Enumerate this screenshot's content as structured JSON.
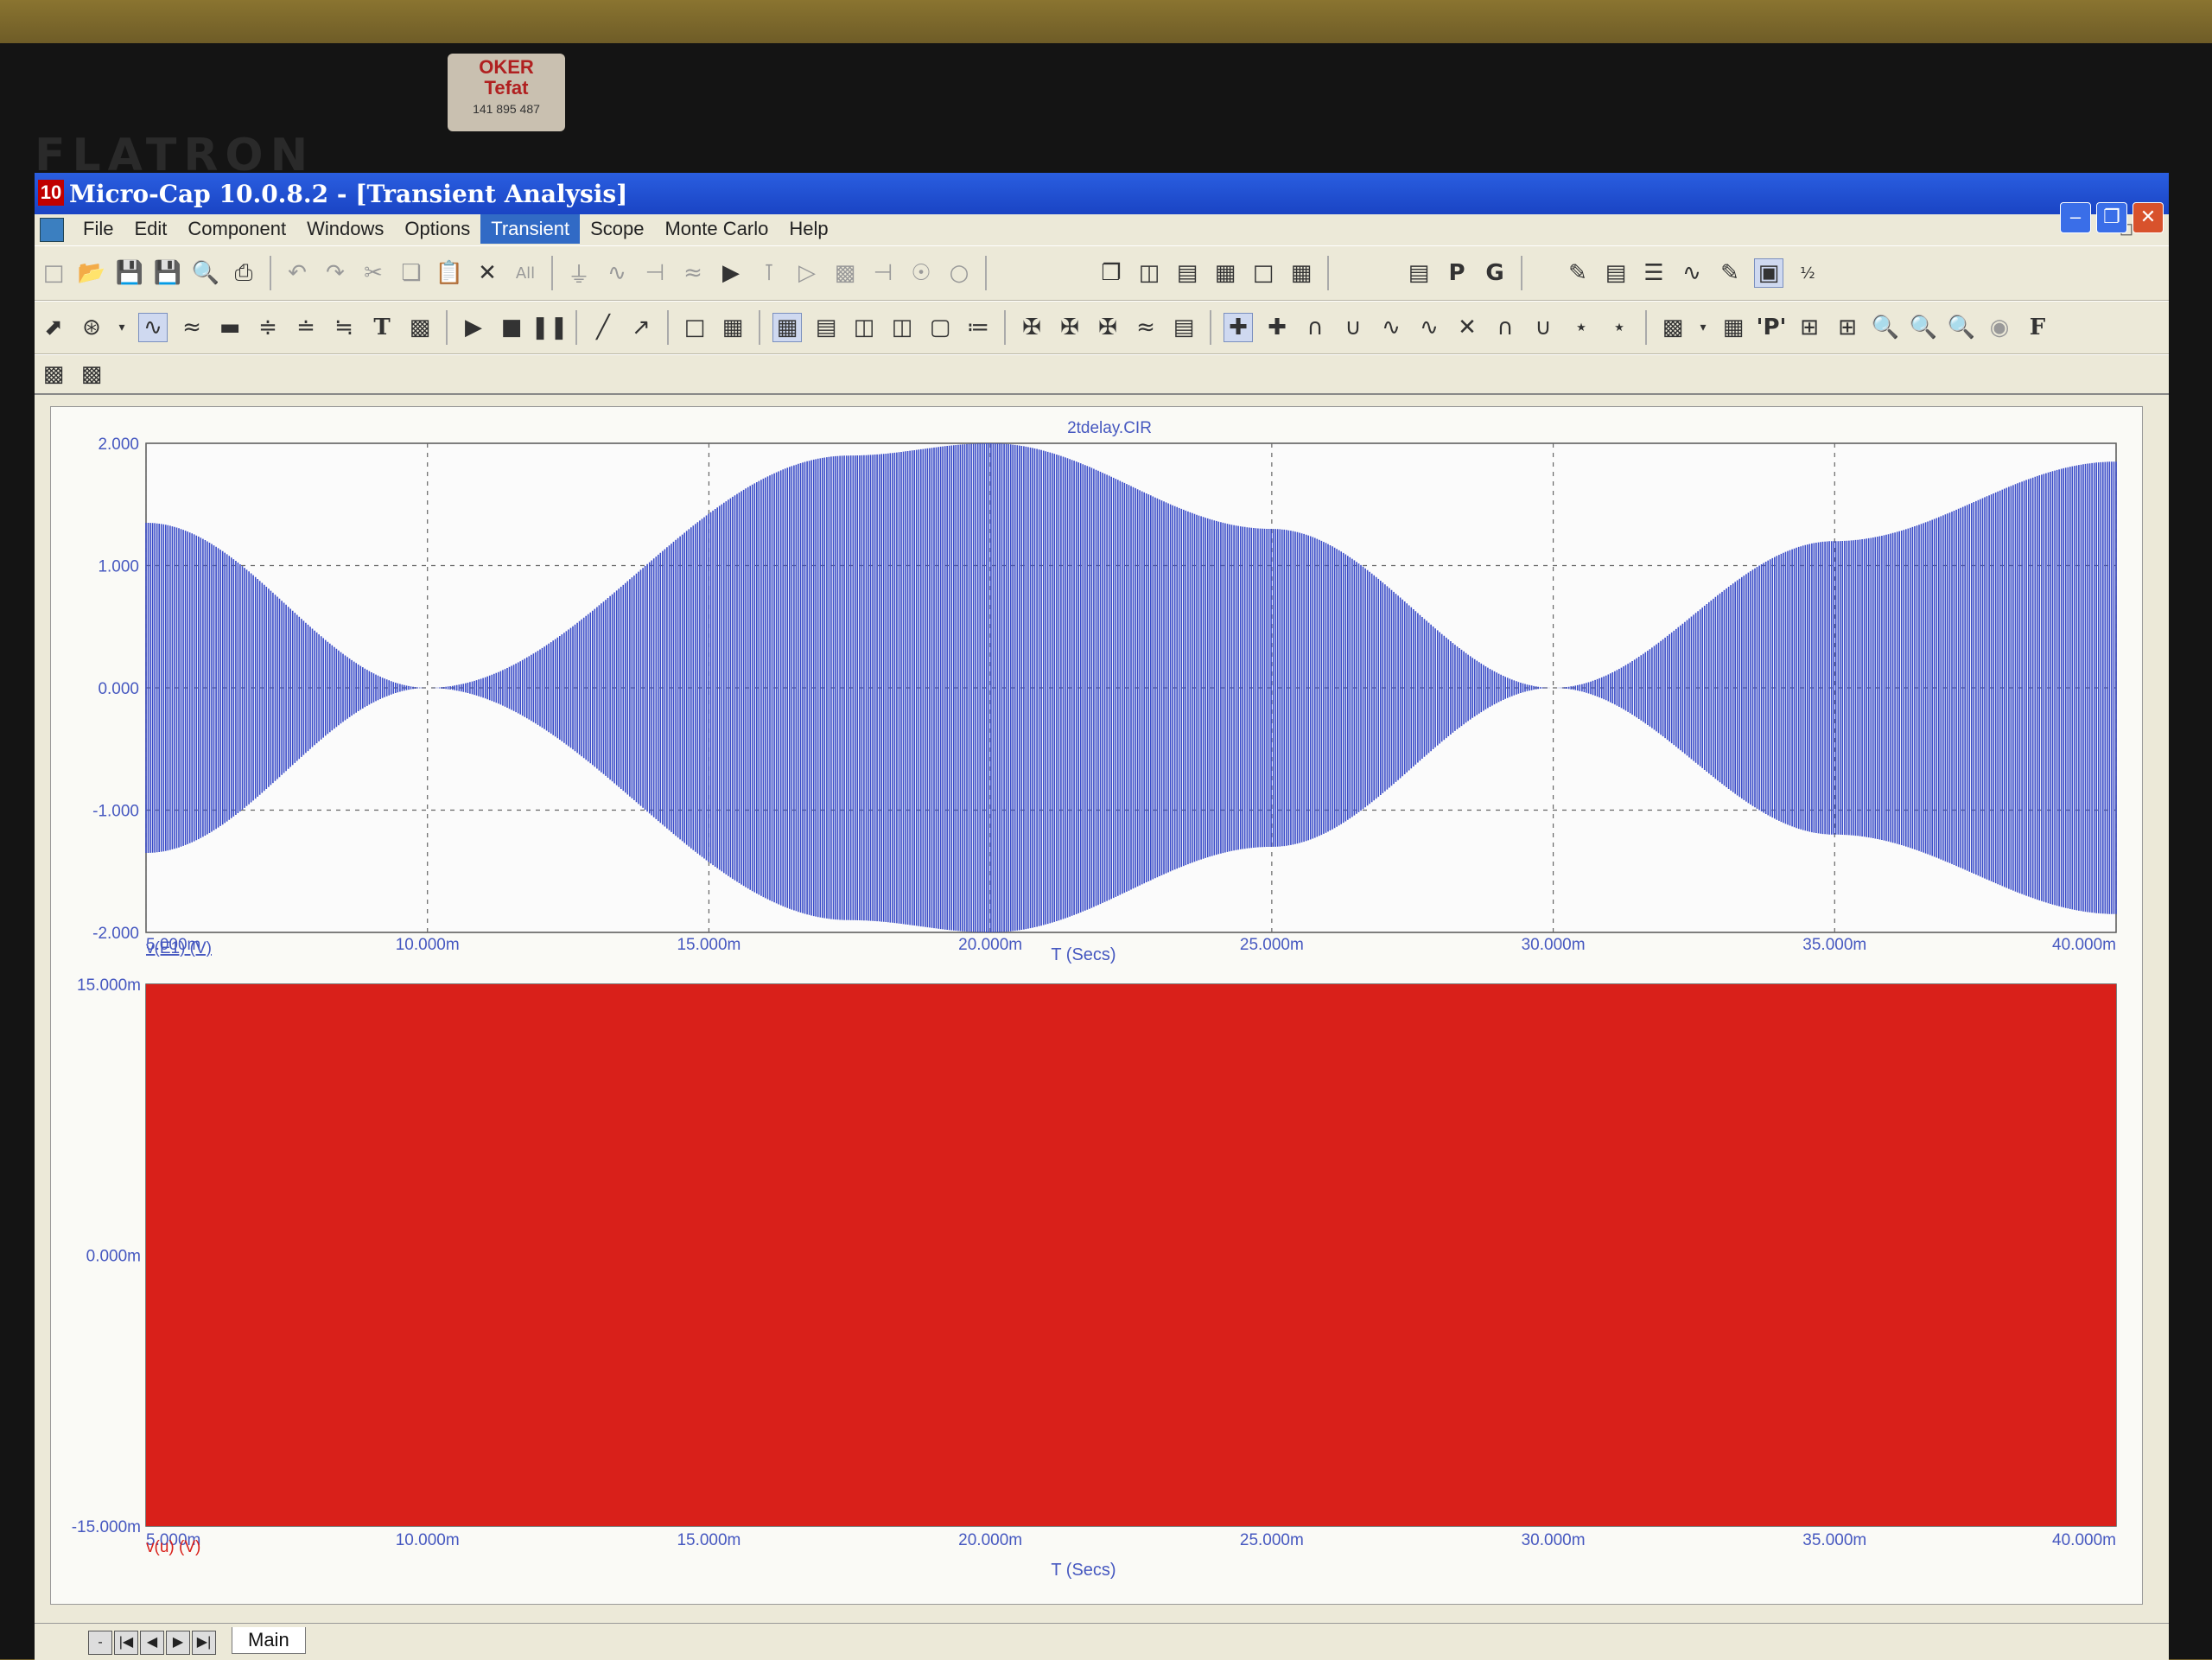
{
  "monitor": {
    "brand": "FLATRON",
    "sticker": {
      "line1": "OKER",
      "line2": "Tefat",
      "phone": "141 895 487"
    }
  },
  "window": {
    "icon_text": "10",
    "title": "Micro-Cap 10.0.8.2 - [Transient Analysis]"
  },
  "menu": {
    "items": [
      "File",
      "Edit",
      "Component",
      "Windows",
      "Options",
      "Transient",
      "Scope",
      "Monte Carlo",
      "Help"
    ],
    "active": "Transient"
  },
  "toolbar": {
    "all_label": "All",
    "p_label": "P",
    "g_label": "G",
    "t_label": "T",
    "f_label": "F"
  },
  "plot": {
    "circuit_title": "2tdelay.CIR",
    "top": {
      "trace_label": "v(E1) (V)",
      "xlabel": "T (Secs)",
      "y_ticks": [
        "2.000",
        "1.000",
        "0.000",
        "-1.000",
        "-2.000"
      ],
      "x_ticks": [
        "5.000m",
        "10.000m",
        "15.000m",
        "20.000m",
        "25.000m",
        "30.000m",
        "35.000m",
        "40.000m"
      ],
      "trace_color": "#3a4cc8"
    },
    "bottom": {
      "trace_label": "v(u) (V)",
      "xlabel": "T (Secs)",
      "y_ticks": [
        "15.000m",
        "0.000m",
        "-15.000m"
      ],
      "x_ticks": [
        "5.000m",
        "10.000m",
        "15.000m",
        "20.000m",
        "25.000m",
        "30.000m",
        "35.000m",
        "40.000m"
      ],
      "trace_color": "#d9201a"
    }
  },
  "chart_data": [
    {
      "type": "line",
      "title": "2tdelay.CIR",
      "xlabel": "T (Secs)",
      "ylabel": "",
      "series": [
        {
          "name": "v(E1) (V)",
          "envelope_x": [
            0.005,
            0.01,
            0.0175,
            0.02,
            0.025,
            0.03,
            0.035,
            0.04
          ],
          "envelope_amplitude": [
            1.35,
            0.0,
            1.9,
            2.0,
            1.3,
            0.0,
            1.2,
            1.85
          ]
        }
      ],
      "xlim": [
        0.005,
        0.04
      ],
      "ylim": [
        -2.0,
        2.0
      ],
      "grid": true
    },
    {
      "type": "area",
      "title": "",
      "xlabel": "T (Secs)",
      "ylabel": "",
      "series": [
        {
          "name": "v(u) (V)",
          "x": [
            0.005,
            0.04
          ],
          "y_min": [
            -0.015,
            -0.015
          ],
          "y_max": [
            0.015,
            0.015
          ]
        }
      ],
      "xlim": [
        0.005,
        0.04
      ],
      "ylim": [
        -0.015,
        0.015
      ],
      "grid": false
    }
  ],
  "tabs": {
    "main_label": "Main"
  }
}
